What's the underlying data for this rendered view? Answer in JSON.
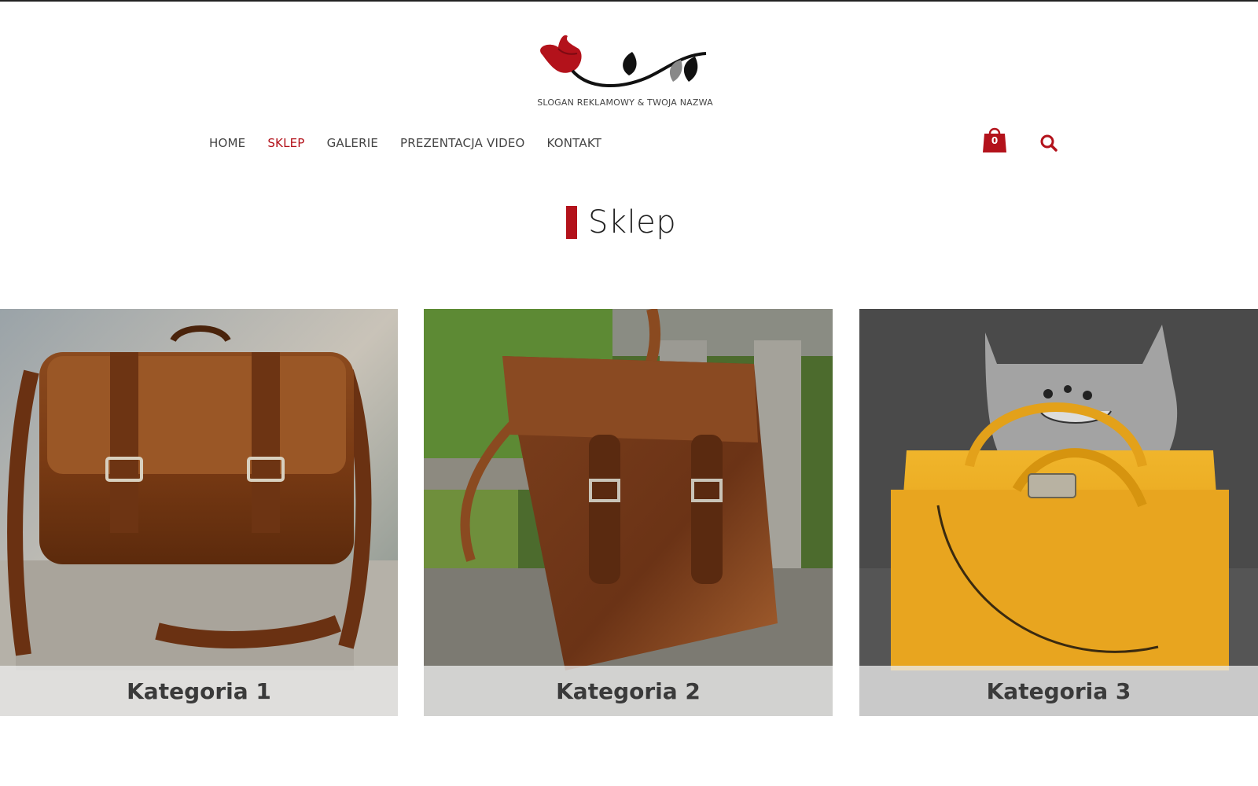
{
  "header": {
    "slogan": "SLOGAN REKLAMOWY & TWOJA NAZWA",
    "logo_colors": {
      "flower": "#b3121b",
      "leaf_dark": "#111111",
      "leaf_grey": "#888888"
    }
  },
  "nav": {
    "items": [
      {
        "label": "HOME",
        "active": false
      },
      {
        "label": "SKLEP",
        "active": true
      },
      {
        "label": "GALERIE",
        "active": false
      },
      {
        "label": "PREZENTACJA VIDEO",
        "active": false
      },
      {
        "label": "KONTAKT",
        "active": false
      }
    ],
    "cart_count": "0",
    "cart_icon": "shopping-bag-icon",
    "search_icon": "search-icon"
  },
  "page": {
    "title": "Sklep",
    "accent_color": "#b3121b"
  },
  "categories": [
    {
      "label": "Kategoria 1",
      "image": "brown leather messenger bag on stone"
    },
    {
      "label": "Kategoria 2",
      "image": "brown leather backpack on wooden bench"
    },
    {
      "label": "Kategoria 3",
      "image": "yellow handbag with grey cat pillow"
    }
  ]
}
